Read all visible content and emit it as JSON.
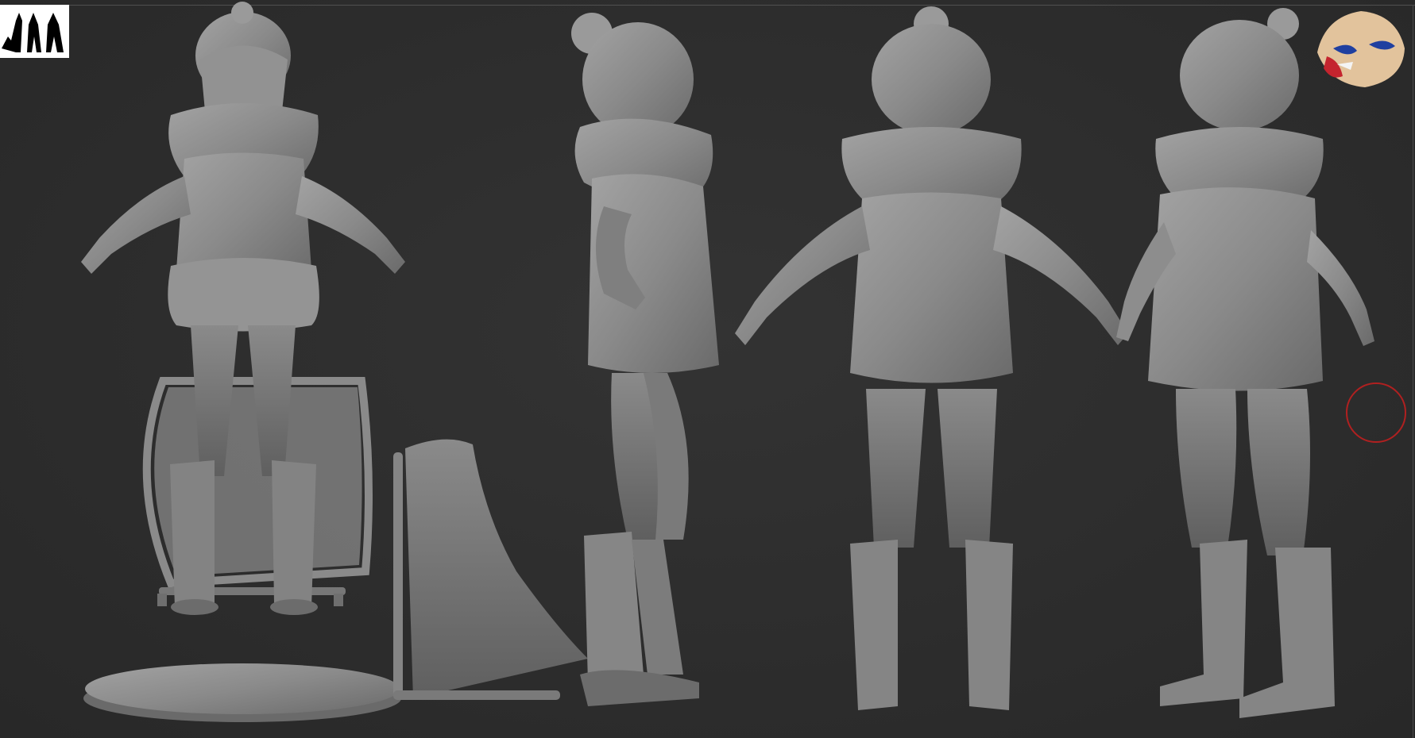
{
  "viewport": {
    "background": "#2d2d2d",
    "model_color": "#8c8c8c",
    "cursor_color": "#b02020"
  },
  "thumbnails": {
    "silhouette_icon": "silhouette-thumbnail-icon",
    "mask_icon": "boar-mask-thumbnail-icon",
    "mask_colors": [
      "#e6c8a2",
      "#c4242e",
      "#1f3fa0"
    ]
  },
  "figures": [
    {
      "view": "front",
      "icon": "figure-front-icon"
    },
    {
      "view": "side",
      "icon": "figure-side-icon"
    },
    {
      "view": "back",
      "icon": "figure-back-icon"
    },
    {
      "view": "three-quarter",
      "icon": "figure-three-quarter-icon"
    }
  ],
  "props": [
    {
      "name": "camping-chair-front",
      "icon": "chair-front-icon"
    },
    {
      "name": "camping-chair-side",
      "icon": "chair-side-icon"
    },
    {
      "name": "display-base",
      "icon": "base-icon"
    }
  ]
}
